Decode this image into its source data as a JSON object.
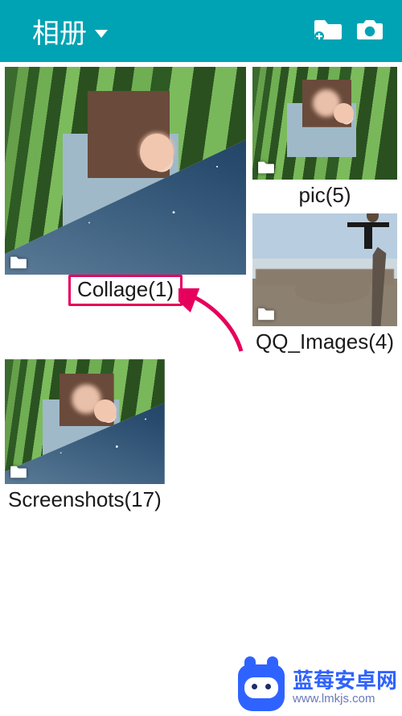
{
  "appbar": {
    "title": "相册",
    "actions": {
      "new_folder_icon": "new-folder-add-icon",
      "camera_icon": "camera-icon"
    }
  },
  "albums": [
    {
      "id": "collage",
      "label": "Collage(1)",
      "size": "large",
      "highlighted": true,
      "thumb_kind": "collage"
    },
    {
      "id": "pic",
      "label": "pic(5)",
      "size": "small",
      "highlighted": false,
      "thumb_kind": "bamboo"
    },
    {
      "id": "qq_images",
      "label": "QQ_Images(4)",
      "size": "small",
      "highlighted": false,
      "thumb_kind": "mountain"
    },
    {
      "id": "screenshots",
      "label": "Screenshots(17)",
      "size": "small",
      "highlighted": false,
      "thumb_kind": "bamboo"
    }
  ],
  "annotation": {
    "arrow_color": "#e6005c"
  },
  "watermark": {
    "brand": "蓝莓安卓网",
    "url_text": "www.lmkjs.com"
  }
}
